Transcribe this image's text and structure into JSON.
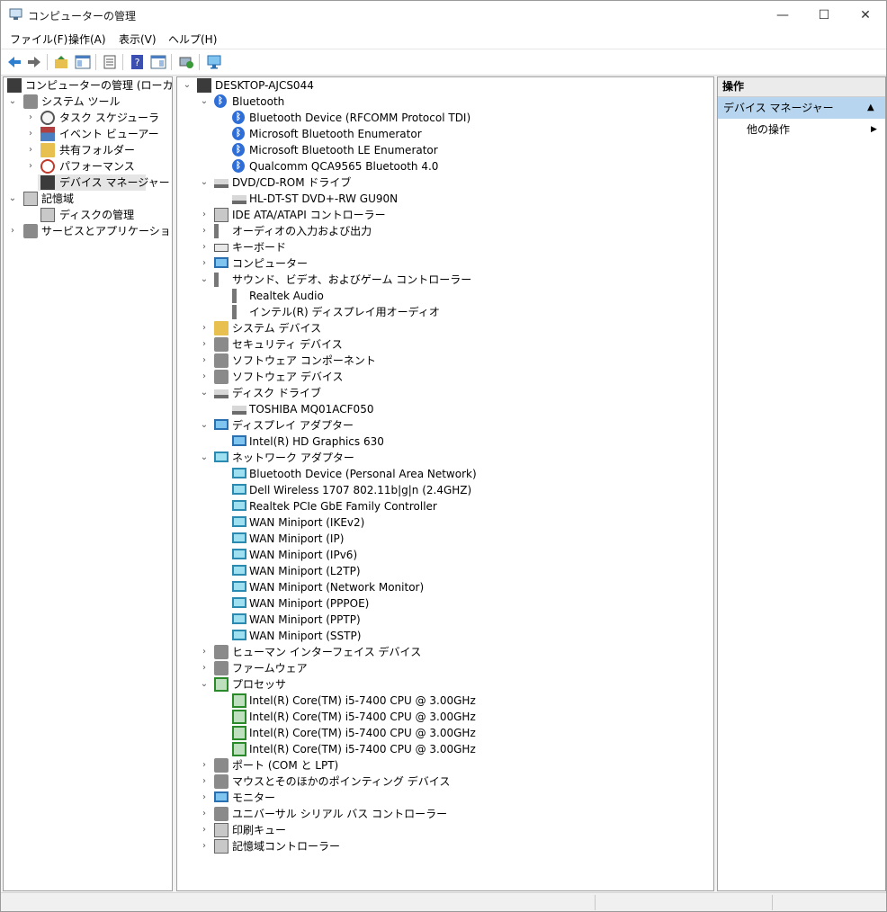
{
  "window": {
    "title": "コンピューターの管理",
    "minimize": "—",
    "maximize": "☐",
    "close": "✕"
  },
  "menu": [
    "ファイル(F)",
    "操作(A)",
    "表示(V)",
    "ヘルプ(H)"
  ],
  "toolbar": {
    "buttons": [
      "back-icon",
      "forward-icon",
      "up-folder-icon",
      "console-tree-icon",
      "properties-icon",
      "help-icon",
      "show-pane-icon",
      "scan-hardware-icon",
      "monitor-icon"
    ]
  },
  "left_tree": [
    {
      "label": "コンピューターの管理 (ローカル)",
      "chev": ""
    },
    {
      "label": "システム ツール",
      "chev": "⌄"
    },
    {
      "label": "タスク スケジューラ",
      "chev": "›"
    },
    {
      "label": "イベント ビューアー",
      "chev": "›"
    },
    {
      "label": "共有フォルダー",
      "chev": "›"
    },
    {
      "label": "パフォーマンス",
      "chev": "›"
    },
    {
      "label": "デバイス マネージャー",
      "chev": "",
      "selected": true
    },
    {
      "label": "記憶域",
      "chev": "⌄"
    },
    {
      "label": "ディスクの管理",
      "chev": ""
    },
    {
      "label": "サービスとアプリケーション",
      "chev": "›"
    }
  ],
  "device_tree": [
    {
      "label": "DESKTOP-AJCS044",
      "level": 0,
      "chev": "⌄",
      "icon": "computer"
    },
    {
      "label": "Bluetooth",
      "level": 1,
      "chev": "⌄",
      "icon": "bt"
    },
    {
      "label": "Bluetooth Device (RFCOMM Protocol TDI)",
      "level": 2,
      "icon": "bt"
    },
    {
      "label": "Microsoft Bluetooth Enumerator",
      "level": 2,
      "icon": "bt"
    },
    {
      "label": "Microsoft Bluetooth LE Enumerator",
      "level": 2,
      "icon": "bt"
    },
    {
      "label": "Qualcomm QCA9565 Bluetooth 4.0",
      "level": 2,
      "icon": "bt"
    },
    {
      "label": "DVD/CD-ROM ドライブ",
      "level": 1,
      "chev": "⌄",
      "icon": "dvd"
    },
    {
      "label": "HL-DT-ST DVD+-RW GU90N",
      "level": 2,
      "icon": "dvd"
    },
    {
      "label": "IDE ATA/ATAPI コントローラー",
      "level": 1,
      "chev": "›",
      "icon": "disk"
    },
    {
      "label": "オーディオの入力および出力",
      "level": 1,
      "chev": "›",
      "icon": "spk"
    },
    {
      "label": "キーボード",
      "level": 1,
      "chev": "›",
      "icon": "kbd"
    },
    {
      "label": "コンピューター",
      "level": 1,
      "chev": "›",
      "icon": "mon"
    },
    {
      "label": "サウンド、ビデオ、およびゲーム コントローラー",
      "level": 1,
      "chev": "⌄",
      "icon": "spk"
    },
    {
      "label": "Realtek Audio",
      "level": 2,
      "icon": "spk"
    },
    {
      "label": "インテル(R) ディスプレイ用オーディオ",
      "level": 2,
      "icon": "spk"
    },
    {
      "label": "システム デバイス",
      "level": 1,
      "chev": "›",
      "icon": "folder"
    },
    {
      "label": "セキュリティ デバイス",
      "level": 1,
      "chev": "›",
      "icon": "gray"
    },
    {
      "label": "ソフトウェア コンポーネント",
      "level": 1,
      "chev": "›",
      "icon": "gray"
    },
    {
      "label": "ソフトウェア デバイス",
      "level": 1,
      "chev": "›",
      "icon": "gray"
    },
    {
      "label": "ディスク ドライブ",
      "level": 1,
      "chev": "⌄",
      "icon": "dvd"
    },
    {
      "label": "TOSHIBA MQ01ACF050",
      "level": 2,
      "icon": "dvd"
    },
    {
      "label": "ディスプレイ アダプター",
      "level": 1,
      "chev": "⌄",
      "icon": "mon"
    },
    {
      "label": "Intel(R) HD Graphics 630",
      "level": 2,
      "icon": "mon"
    },
    {
      "label": "ネットワーク アダプター",
      "level": 1,
      "chev": "⌄",
      "icon": "net"
    },
    {
      "label": "Bluetooth Device (Personal Area Network)",
      "level": 2,
      "icon": "net"
    },
    {
      "label": "Dell Wireless 1707 802.11b|g|n (2.4GHZ)",
      "level": 2,
      "icon": "net"
    },
    {
      "label": "Realtek PCIe GbE Family Controller",
      "level": 2,
      "icon": "net"
    },
    {
      "label": "WAN Miniport (IKEv2)",
      "level": 2,
      "icon": "net"
    },
    {
      "label": "WAN Miniport (IP)",
      "level": 2,
      "icon": "net"
    },
    {
      "label": "WAN Miniport (IPv6)",
      "level": 2,
      "icon": "net"
    },
    {
      "label": "WAN Miniport (L2TP)",
      "level": 2,
      "icon": "net"
    },
    {
      "label": "WAN Miniport (Network Monitor)",
      "level": 2,
      "icon": "net"
    },
    {
      "label": "WAN Miniport (PPPOE)",
      "level": 2,
      "icon": "net"
    },
    {
      "label": "WAN Miniport (PPTP)",
      "level": 2,
      "icon": "net"
    },
    {
      "label": "WAN Miniport (SSTP)",
      "level": 2,
      "icon": "net"
    },
    {
      "label": "ヒューマン インターフェイス デバイス",
      "level": 1,
      "chev": "›",
      "icon": "gray"
    },
    {
      "label": "ファームウェア",
      "level": 1,
      "chev": "›",
      "icon": "gray"
    },
    {
      "label": "プロセッサ",
      "level": 1,
      "chev": "⌄",
      "icon": "cpu"
    },
    {
      "label": "Intel(R) Core(TM) i5-7400 CPU @ 3.00GHz",
      "level": 2,
      "icon": "cpu"
    },
    {
      "label": "Intel(R) Core(TM) i5-7400 CPU @ 3.00GHz",
      "level": 2,
      "icon": "cpu"
    },
    {
      "label": "Intel(R) Core(TM) i5-7400 CPU @ 3.00GHz",
      "level": 2,
      "icon": "cpu"
    },
    {
      "label": "Intel(R) Core(TM) i5-7400 CPU @ 3.00GHz",
      "level": 2,
      "icon": "cpu"
    },
    {
      "label": "ポート (COM と LPT)",
      "level": 1,
      "chev": "›",
      "icon": "gray"
    },
    {
      "label": "マウスとそのほかのポインティング デバイス",
      "level": 1,
      "chev": "›",
      "icon": "gray"
    },
    {
      "label": "モニター",
      "level": 1,
      "chev": "›",
      "icon": "mon"
    },
    {
      "label": "ユニバーサル シリアル バス コントローラー",
      "level": 1,
      "chev": "›",
      "icon": "gray"
    },
    {
      "label": "印刷キュー",
      "level": 1,
      "chev": "›",
      "icon": "disk"
    },
    {
      "label": "記憶域コントローラー",
      "level": 1,
      "chev": "›",
      "icon": "disk"
    }
  ],
  "actions": {
    "header": "操作",
    "section": "デバイス マネージャー",
    "section_toggle": "▲",
    "more": "他の操作",
    "more_arrow": "▶"
  }
}
